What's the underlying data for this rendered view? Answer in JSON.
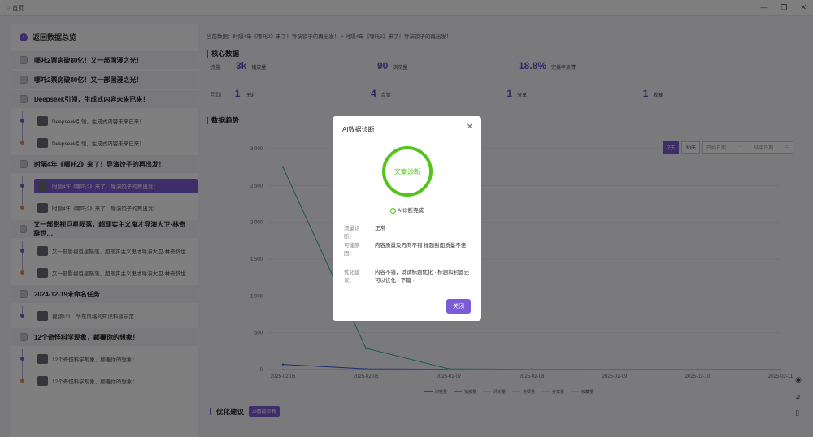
{
  "window": {
    "home_label": "首页",
    "min": "—",
    "max": "❐",
    "close": "✕"
  },
  "sidebar": {
    "back_label": "返回数据总览",
    "groups": [
      {
        "title": "哪吒2票房破80亿！又一部国漫之光！",
        "subs": []
      },
      {
        "title": "哪吒2票房破80亿！又一部国漫之光！",
        "subs": []
      },
      {
        "title": "Deepseek引领，生成式内容未来已来！",
        "subs": [
          "Deepseek引领，生成式内容未来已来！",
          "Deepseek引领，生成式内容未来已来！"
        ]
      },
      {
        "title": "时隔4年《哪吒2》来了！导演饺子的再出发！",
        "subs": [
          "时隔4年《哪吒2》来了！导演饺子的再出发！",
          "时隔4年《哪吒2》来了！导演饺子的再出发！"
        ]
      },
      {
        "title": "又一部影视巨星陨落，超现实主义鬼才导演大卫·林奇辞世…",
        "subs": [
          "又一部影视巨星陨落，超现实主义鬼才导演大卫·林奇辞世",
          "又一部影视巨星陨落，超现实主义鬼才导演大卫·林奇辞世"
        ]
      },
      {
        "title": "2024-12-19未命名任务",
        "subs": [
          "视频111：华东风格的知识科普示范"
        ]
      },
      {
        "title": "12个奇怪科学现象，颠覆你的想象！",
        "subs": [
          "12个奇怪科学现象，颠覆你的想象！",
          "12个奇怪科学现象，颠覆你的想象！"
        ]
      }
    ]
  },
  "breadcrumb": {
    "text": "当前数据：时隔4年《哪吒2》来了！导演饺子的再出发！  >  时隔4年《哪吒2》来了！导演饺子的再出发！"
  },
  "core": {
    "title": "核心数据",
    "rows": [
      {
        "label": "流量",
        "items": [
          {
            "v": "3k",
            "n": "播放量"
          },
          {
            "v": "90",
            "n": "浏览量"
          },
          {
            "v": "18.8%",
            "n": "完播率点赞"
          }
        ]
      },
      {
        "label": "互动",
        "items": [
          {
            "v": "1",
            "n": "评论"
          },
          {
            "v": "4",
            "n": "点赞"
          },
          {
            "v": "1",
            "n": "分享"
          },
          {
            "v": "1",
            "n": "收藏"
          }
        ]
      }
    ]
  },
  "trend": {
    "title": "数据趋势",
    "btn7": "7天",
    "btn30": "30天",
    "date_start": "开始日期",
    "date_sep": "→",
    "date_end": "结束日期"
  },
  "chart_data": {
    "type": "line",
    "x": [
      "2025-02-05",
      "2025-02-06",
      "2025-02-07",
      "2025-02-08",
      "2025-02-09",
      "2025-02-10",
      "2025-02-11"
    ],
    "y_ticks": [
      "3,000",
      "2,500",
      "2,000",
      "1,500",
      "1,000",
      "500",
      "0"
    ],
    "ylim": [
      0,
      3000
    ],
    "series": [
      {
        "name": "浏览量",
        "color": "#3d5bd8",
        "values": [
          70,
          10,
          5,
          2,
          2,
          1,
          1
        ]
      },
      {
        "name": "播放量",
        "color": "#2fb58a",
        "values": [
          2750,
          290,
          10,
          3,
          2,
          2,
          2
        ]
      },
      {
        "name": "评论量",
        "color": "#cfcfcf",
        "values": [
          0,
          0,
          0,
          0,
          0,
          0,
          0
        ]
      },
      {
        "name": "点赞量",
        "color": "#cfcfcf",
        "values": [
          0,
          0,
          0,
          0,
          0,
          0,
          0
        ]
      },
      {
        "name": "分享量",
        "color": "#cfcfcf",
        "values": [
          0,
          0,
          0,
          0,
          0,
          0,
          0
        ]
      },
      {
        "name": "收藏量",
        "color": "#cfcfcf",
        "values": [
          0,
          0,
          0,
          0,
          0,
          0,
          0
        ]
      }
    ]
  },
  "optimize": {
    "title": "优化建议",
    "ai_btn": "AI智能诊断"
  },
  "modal": {
    "title": "AI数据诊断",
    "close": "✕",
    "ring_text": "文案诊断",
    "done": "AI诊断完成",
    "check": "✓",
    "rows": [
      {
        "k": "流量诊断：",
        "v": "正常"
      },
      {
        "k": "可能原因：",
        "v": "内容质量及方向不错 标题封面质量不佳"
      },
      {
        "k": "优化建议：",
        "v": "内容不错，试试标题优化 · 标题和封面还可以优化 · 下篇 ·"
      }
    ],
    "ok": "关闭"
  },
  "colors": {
    "accent": "#7b5cd6",
    "success": "#52c41a"
  }
}
